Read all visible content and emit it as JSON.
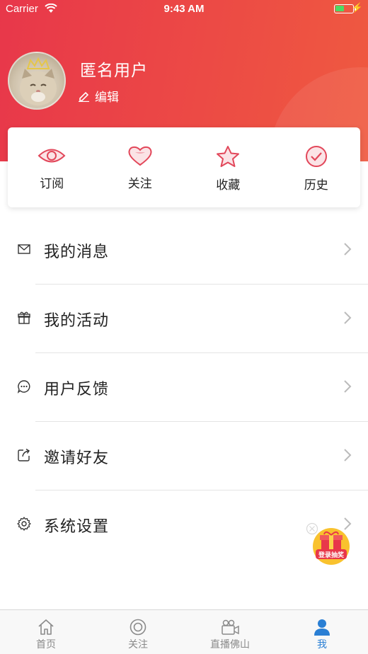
{
  "status_bar": {
    "carrier": "Carrier",
    "time": "9:43 AM"
  },
  "profile": {
    "username": "匿名用户",
    "edit_label": "编辑"
  },
  "quick_actions": [
    {
      "label": "订阅",
      "icon": "eye-icon"
    },
    {
      "label": "关注",
      "icon": "heart-icon"
    },
    {
      "label": "收藏",
      "icon": "star-icon"
    },
    {
      "label": "历史",
      "icon": "check-circle-icon"
    }
  ],
  "menu": [
    {
      "label": "我的消息",
      "icon": "mail-icon"
    },
    {
      "label": "我的活动",
      "icon": "gift-icon"
    },
    {
      "label": "用户反馈",
      "icon": "chat-icon"
    },
    {
      "label": "邀请好友",
      "icon": "share-icon"
    },
    {
      "label": "系统设置",
      "icon": "gear-icon"
    }
  ],
  "reward": {
    "label": "登录抽奖"
  },
  "tabs": [
    {
      "label": "首页",
      "icon": "home-icon",
      "active": false
    },
    {
      "label": "关注",
      "icon": "focus-icon",
      "active": false
    },
    {
      "label": "直播佛山",
      "icon": "video-camera-icon",
      "active": false
    },
    {
      "label": "我",
      "icon": "person-icon",
      "active": true
    }
  ],
  "colors": {
    "header_start": "#e8374a",
    "header_end": "#ef5a40",
    "accent_icon": "#e2475a",
    "tab_active": "#2a7fd4"
  }
}
